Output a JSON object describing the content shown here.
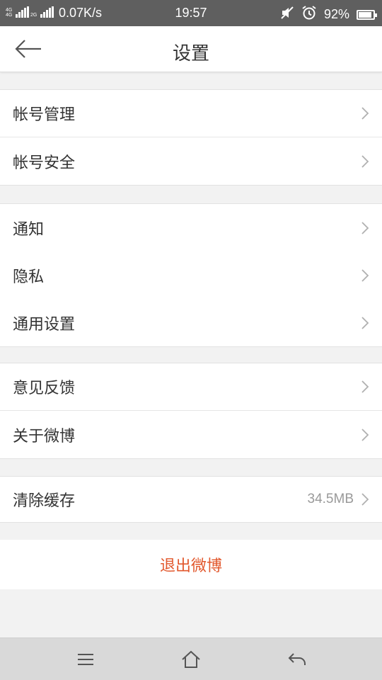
{
  "status_bar": {
    "signal_tag_1": "4G 4G",
    "signal_tag_2": "2G",
    "net_speed": "0.07K/s",
    "time": "19:57",
    "battery": "92%",
    "battery_level": 0.92
  },
  "header": {
    "title": "设置",
    "back_icon": "arrow-left-icon"
  },
  "groups": [
    {
      "items": [
        {
          "label": "帐号管理"
        },
        {
          "label": "帐号安全"
        }
      ]
    },
    {
      "items": [
        {
          "label": "通知"
        },
        {
          "label": "隐私"
        },
        {
          "label": "通用设置"
        }
      ]
    },
    {
      "items": [
        {
          "label": "意见反馈"
        },
        {
          "label": "关于微博"
        }
      ]
    },
    {
      "items": [
        {
          "label": "清除缓存",
          "value": "34.5MB"
        }
      ]
    }
  ],
  "logout_label": "退出微博",
  "colors": {
    "accent": "#e2582d",
    "status_bar": "#5f5f5f",
    "background": "#f2f2f2"
  },
  "navbar": {
    "menu_icon": "menu-icon",
    "home_icon": "home-icon",
    "back_icon": "back-icon"
  }
}
